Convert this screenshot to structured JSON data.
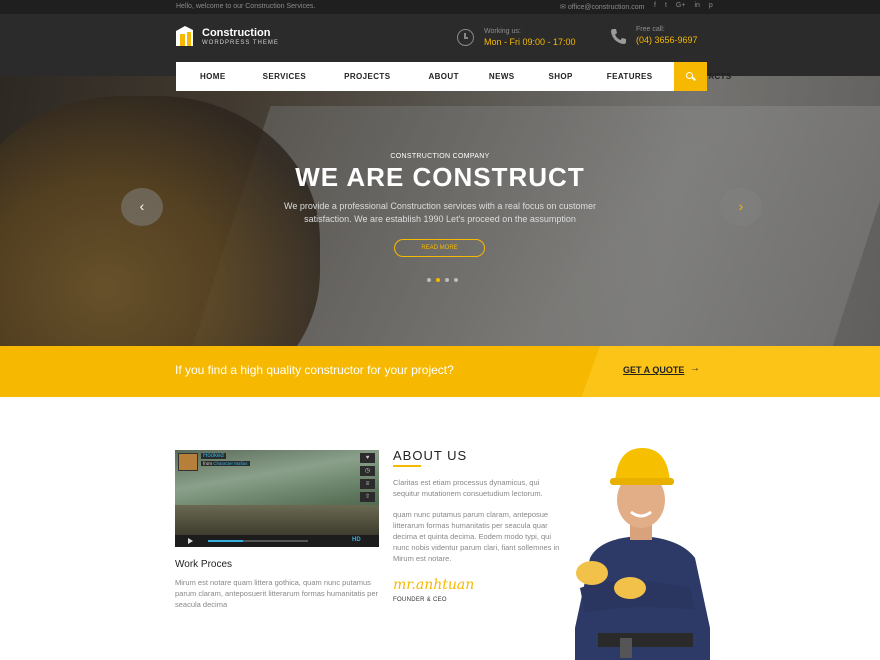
{
  "topbar": {
    "welcome": "Hello, welcome to our Construction Services.",
    "email": "office@construction.com",
    "socials": [
      {
        "icon": "facebook-icon",
        "glyph": "f"
      },
      {
        "icon": "twitter-icon",
        "glyph": "t"
      },
      {
        "icon": "googleplus-icon",
        "glyph": "G+"
      },
      {
        "icon": "linkedin-icon",
        "glyph": "in"
      },
      {
        "icon": "pinterest-icon",
        "glyph": "p"
      }
    ]
  },
  "header": {
    "brand_title": "Construction",
    "brand_sub": "WORDPRESS THEME",
    "work_label": "Working us:",
    "work_hours": "Mon - Fri 09:00 - 17:00",
    "call_label": "Free call:",
    "call_number": "(04) 3656-9697"
  },
  "nav": {
    "items": [
      "HOME",
      "SERVICES",
      "PROJECTS",
      "ABOUT",
      "NEWS",
      "SHOP",
      "FEATURES",
      "CONTACTS"
    ]
  },
  "hero": {
    "kicker": "CONSTRUCTION COMPANY",
    "title": "WE ARE CONSTRUCT",
    "text": "We provide a professional Construction services with a real focus on customer satisfaction. We are establish 1990 Let's proceed on the assumption",
    "button": "READ MORE",
    "prev_glyph": "‹",
    "next_glyph": "›"
  },
  "quote": {
    "text": "If you find a high quality constructor for your project?",
    "button": "GET A QUOTE",
    "arrow": "→"
  },
  "video": {
    "title": "Hooked",
    "from_prefix": "from",
    "from_author": "Character Mafias",
    "hd_label": "HD",
    "progress": 0.35
  },
  "work": {
    "title": "Work Proces",
    "text": "Mirum est notare quam littera gothica, quam nunc putamus parum claram, anteposuerit litterarum formas humanitatis per seacula decima"
  },
  "about": {
    "title": "ABOUT US",
    "p1": "Claritas est etiam processus dynamicus, qui sequitur mutationem consuetudium lectorum.",
    "p2": "quam nunc putamus parum claram, anteposue litterarum formas humanitatis per seacula quar decima et quinta decima. Eodem modo typi, qui nunc nobis videntur parum clari, fiant sollemnes in Mirum est notare.",
    "signature": "mr.anhtuan",
    "role": "FOUNDER & CEO"
  },
  "colors": {
    "accent": "#f6b800",
    "dark": "#2b2b2b"
  }
}
